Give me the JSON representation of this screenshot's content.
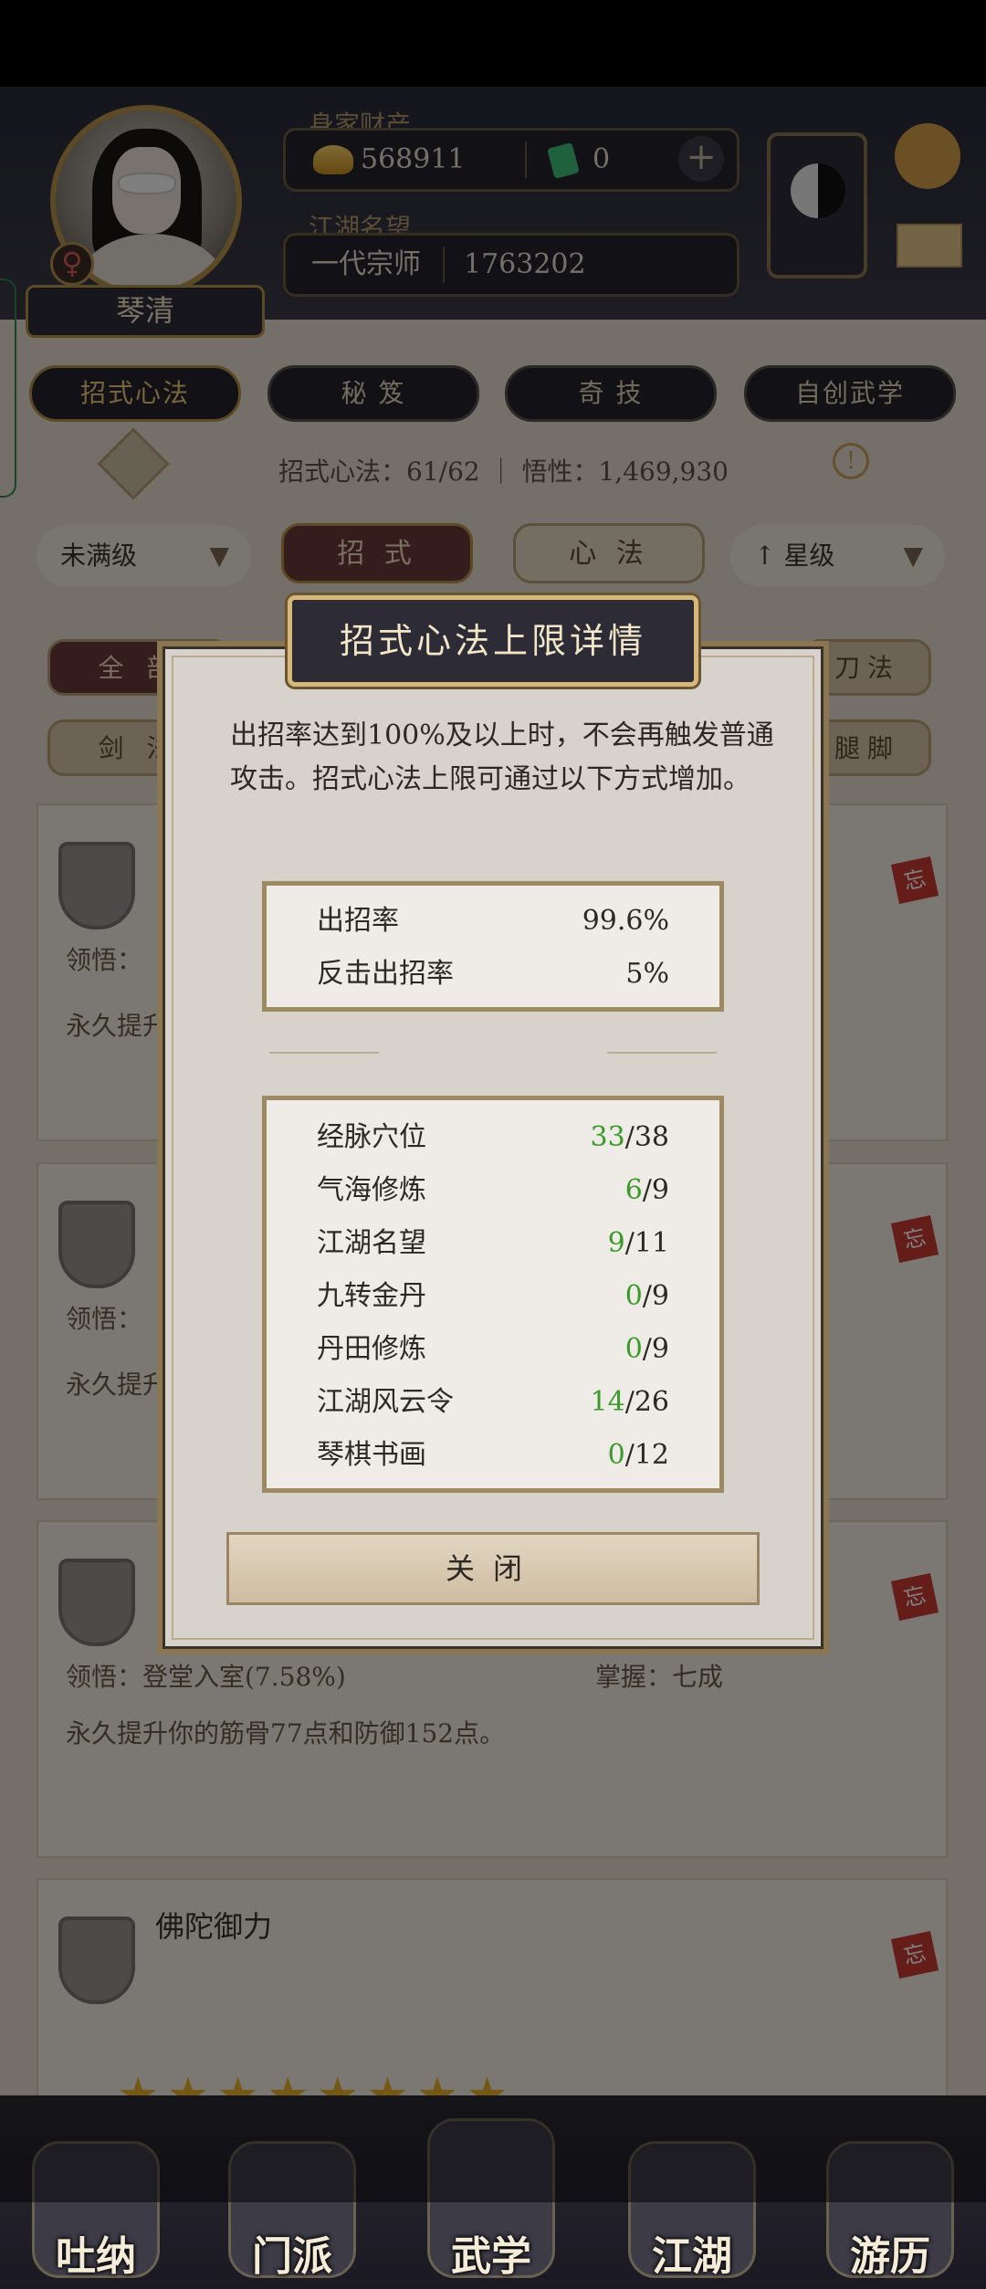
{
  "header": {
    "player_name": "琴清",
    "gender_symbol": "♀",
    "wealth_label": "身家财产",
    "gold_amount": "568911",
    "jade_amount": "0",
    "reputation_label": "江湖名望",
    "reputation_title": "一代宗师",
    "reputation_value": "1763202"
  },
  "tabs": [
    "招式心法",
    "秘 笈",
    "奇 技",
    "自创武学"
  ],
  "info_line": "招式心法：61/62 ｜ 悟性：1,469,930",
  "filters": {
    "level_dropdown": "未满级",
    "segment_moves": "招 式",
    "segment_mind": "心 法",
    "star_sort": "星级"
  },
  "chips": [
    "全 部",
    "剑 法",
    "刀法",
    "腿脚"
  ],
  "cards": {
    "card1_label": "领悟：",
    "card1_desc": "永久提升",
    "card2_label": "领悟：",
    "card2_desc": "永久提升",
    "card3_realm": "领悟：登堂入室(7.58%)",
    "card3_mastery": "掌握：七成",
    "card3_desc": "永久提升你的筋骨77点和防御152点。",
    "card4_name": "佛陀御力",
    "tag": "忘"
  },
  "card4_stars": 8,
  "bottom_nav": [
    "吐纳",
    "门派",
    "武学",
    "江湖",
    "游历"
  ],
  "modal": {
    "title": "招式心法上限详情",
    "description": "出招率达到100%及以上时，不会再触发普通攻击。招式心法上限可通过以下方式增加。",
    "rates": [
      {
        "label": "出招率",
        "value": "99.6%"
      },
      {
        "label": "反击出招率",
        "value": "5%"
      }
    ],
    "sources": [
      {
        "label": "经脉穴位",
        "current": "33",
        "max": "/38"
      },
      {
        "label": "气海修炼",
        "current": "6",
        "max": "/9"
      },
      {
        "label": "江湖名望",
        "current": "9",
        "max": "/11"
      },
      {
        "label": "九转金丹",
        "current": "0",
        "max": "/9"
      },
      {
        "label": "丹田修炼",
        "current": "0",
        "max": "/9"
      },
      {
        "label": "江湖风云令",
        "current": "14",
        "max": "/26"
      },
      {
        "label": "琴棋书画",
        "current": "0",
        "max": "/12"
      }
    ],
    "close_label": "关闭"
  }
}
